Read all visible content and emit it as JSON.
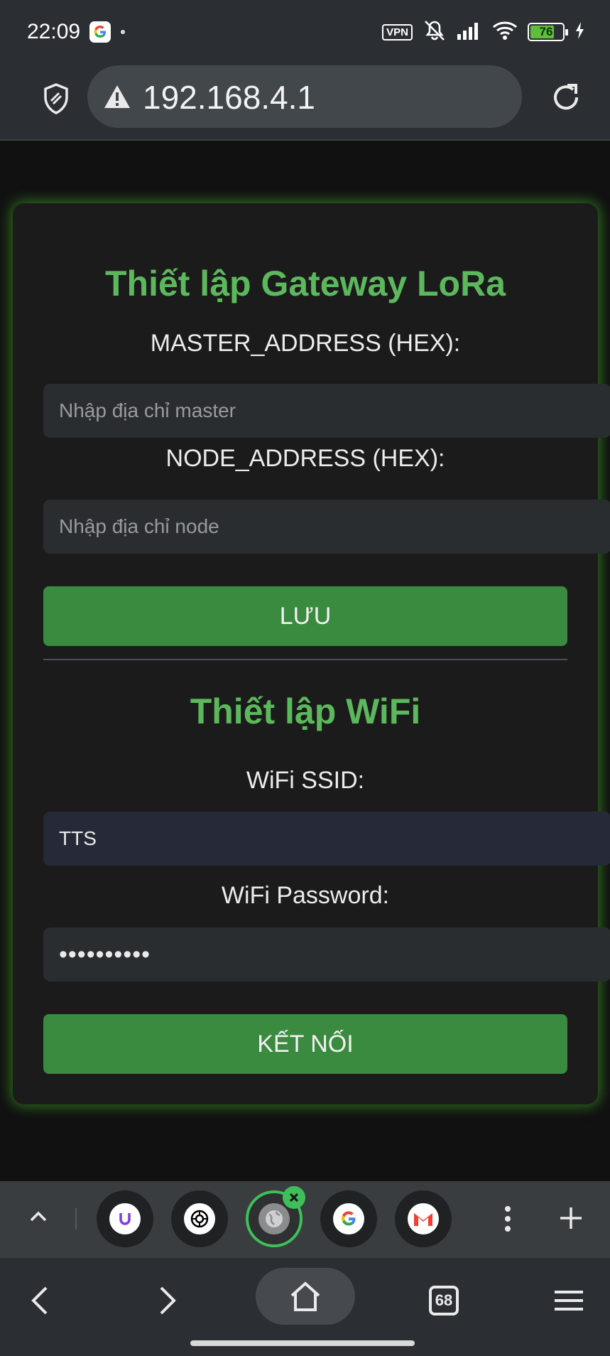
{
  "status_bar": {
    "time": "22:09",
    "vpn_label": "VPN",
    "battery_level": 76,
    "battery_label": "76",
    "icons": [
      "google-icon",
      "dot-icon",
      "vpn-icon",
      "mute-icon",
      "signal-icon",
      "wifi-icon",
      "battery-icon",
      "charging-icon"
    ]
  },
  "browser": {
    "url": "192.168.4.1",
    "icons": [
      "shield-icon",
      "warning-icon",
      "reload-icon"
    ]
  },
  "form": {
    "lora_title": "Thiết lập Gateway LoRa",
    "master_label": "MASTER_ADDRESS (HEX):",
    "master_placeholder": "Nhập địa chỉ master",
    "master_value": "",
    "node_label": "NODE_ADDRESS (HEX):",
    "node_placeholder": "Nhập địa chỉ node",
    "node_value": "",
    "save_button": "LƯU",
    "wifi_title": "Thiết lập WiFi",
    "ssid_label": "WiFi SSID:",
    "ssid_value": "TTS",
    "password_label": "WiFi Password:",
    "password_value": "••••••••••",
    "connect_button": "KẾT NỐI"
  },
  "tab_strip": {
    "tabs": [
      {
        "name": "u-app-tab",
        "glyph": "U",
        "color": "#7b3fe4"
      },
      {
        "name": "chatgpt-tab",
        "glyph": "",
        "color": "#000000"
      },
      {
        "name": "current-tab",
        "glyph": "",
        "color": "#8a8c8e"
      },
      {
        "name": "google-tab",
        "glyph": "G",
        "color": "#4285f4"
      },
      {
        "name": "gmail-tab",
        "glyph": "M",
        "color": "#ea4335"
      }
    ]
  },
  "bottom_nav": {
    "tab_count": "68"
  },
  "colors": {
    "accent_green": "#5cb85c",
    "button_green": "#3a8a3f",
    "glow": "#46be28",
    "active_tab_ring": "#3fbf5a"
  }
}
